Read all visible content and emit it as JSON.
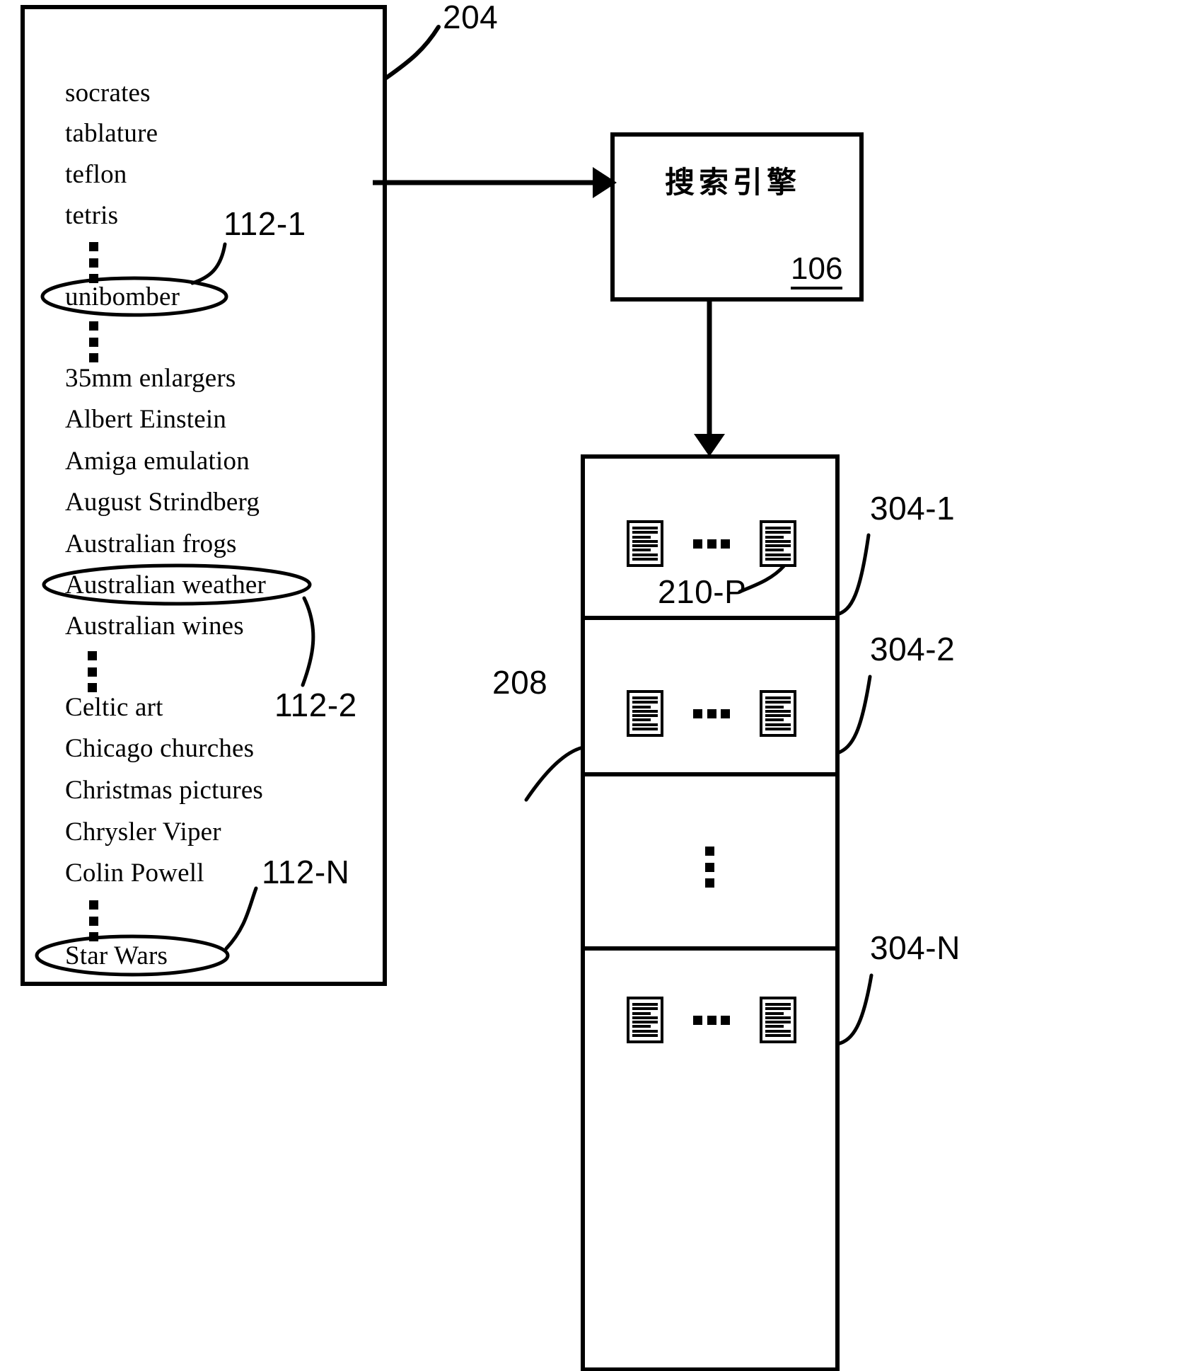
{
  "figure": {
    "query_list_box": {
      "ref": "204",
      "terms": [
        "socrates",
        "tablature",
        "teflon",
        "tetris",
        "unibomber",
        "35mm enlargers",
        "Albert Einstein",
        "Amiga emulation",
        "August Strindberg",
        "Australian frogs",
        "Australian weather",
        "Australian wines",
        "Celtic art",
        "Chicago churches",
        "Christmas pictures",
        "Chrysler Viper",
        "Colin Powell",
        "Star Wars"
      ],
      "circled_terms": [
        {
          "term": "unibomber",
          "ref": "112-1"
        },
        {
          "term": "Australian weather",
          "ref": "112-2"
        },
        {
          "term": "Star Wars",
          "ref": "112-N"
        }
      ]
    },
    "search_engine": {
      "label": "搜索引擎",
      "ref": "106"
    },
    "results": {
      "ref": "208",
      "document_ref": "210-P",
      "groups": [
        {
          "ref": "304-1"
        },
        {
          "ref": "304-2"
        },
        {
          "ref": "304-N"
        }
      ]
    }
  }
}
